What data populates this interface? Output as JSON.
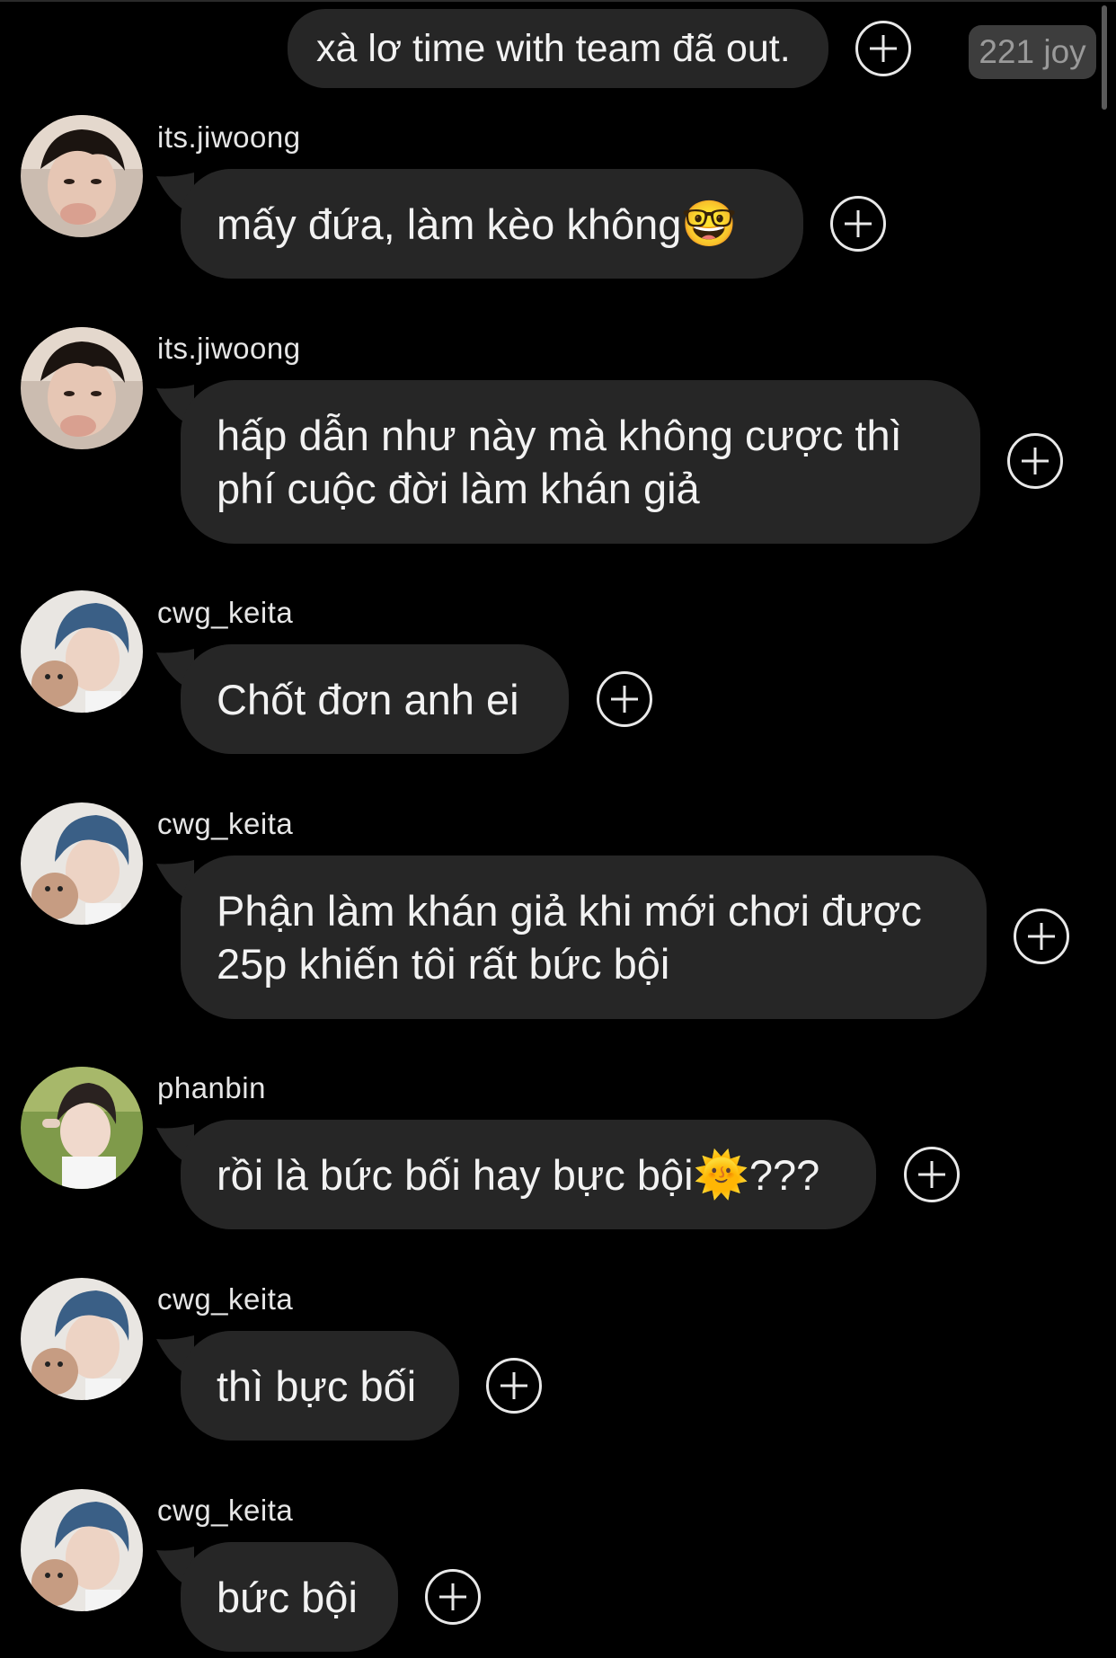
{
  "badge": {
    "text": "221 joy"
  },
  "messages": [
    {
      "type": "sent",
      "text": "xà lơ time with team đã out."
    },
    {
      "user": "its.jiwoong",
      "avatar": "avatar-jiwoong",
      "text": "mấy đứa, làm kèo không",
      "emoji": "🤓"
    },
    {
      "user": "its.jiwoong",
      "avatar": "avatar-jiwoong",
      "line1": "hấp dẫn như này mà không cược thì",
      "line2": "phí cuộc đời làm khán giả"
    },
    {
      "user": "cwg_keita",
      "avatar": "avatar-keita",
      "text": "Chốt đơn anh ei"
    },
    {
      "user": "cwg_keita",
      "avatar": "avatar-keita",
      "line1": "Phận làm khán giả khi mới chơi được",
      "line2": "25p khiến tôi rất bức bội"
    },
    {
      "user": "phanbin",
      "avatar": "avatar-phanbin",
      "text": "rồi là bức bối hay bực bội",
      "emoji": "🌞",
      "after": "???"
    },
    {
      "user": "cwg_keita",
      "avatar": "avatar-keita",
      "text": "thì bực bối"
    },
    {
      "user": "cwg_keita",
      "avatar": "avatar-keita",
      "text": "bức bội"
    }
  ]
}
